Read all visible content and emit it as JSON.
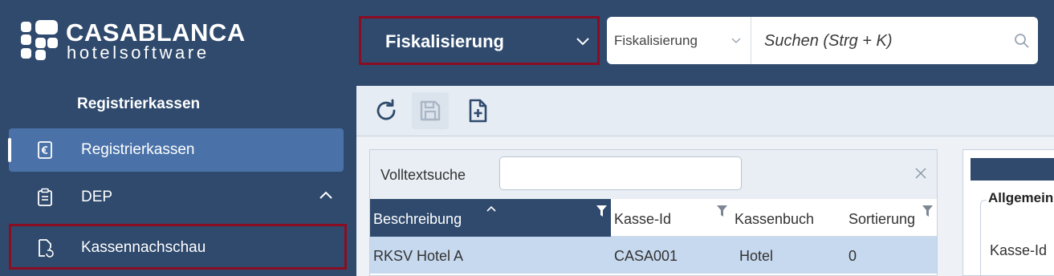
{
  "brand": {
    "title": "CASABLANCA",
    "subtitle": "hotelsoftware"
  },
  "sidebar": {
    "section_title": "Registrierkassen",
    "items": [
      {
        "label": "Registrierkassen",
        "icon": "euro-receipt-icon",
        "active": true
      },
      {
        "label": "DEP",
        "icon": "clipboard-list-icon",
        "expanded": true
      },
      {
        "label": "Kassennachschau",
        "icon": "document-refresh-icon",
        "highlighted": true
      }
    ]
  },
  "header": {
    "module_label": "Fiskalisierung",
    "search": {
      "scope_label": "Fiskalisierung",
      "placeholder": "Suchen (Strg + K)"
    }
  },
  "toolbar": {
    "buttons": [
      {
        "name": "refresh",
        "icon": "refresh-icon",
        "enabled": true
      },
      {
        "name": "save",
        "icon": "save-icon",
        "enabled": false
      },
      {
        "name": "new",
        "icon": "new-document-icon",
        "enabled": true
      }
    ]
  },
  "grid": {
    "fulltext_label": "Volltextsuche",
    "fulltext_value": "",
    "columns": [
      "Beschreibung",
      "Kasse-Id",
      "Kassenbuch",
      "Sortierung"
    ],
    "sorted_column": "Beschreibung",
    "rows": [
      [
        "RKSV Hotel A",
        "CASA001",
        "Hotel",
        "0"
      ]
    ]
  },
  "detail": {
    "group_legend": "Allgemein",
    "field_label": "Kasse-Id"
  },
  "colors": {
    "navy": "#2f4a6d",
    "active_nav": "#4a72a8",
    "highlight_border": "#8b0d22",
    "selected_row": "#c7d9ef"
  }
}
